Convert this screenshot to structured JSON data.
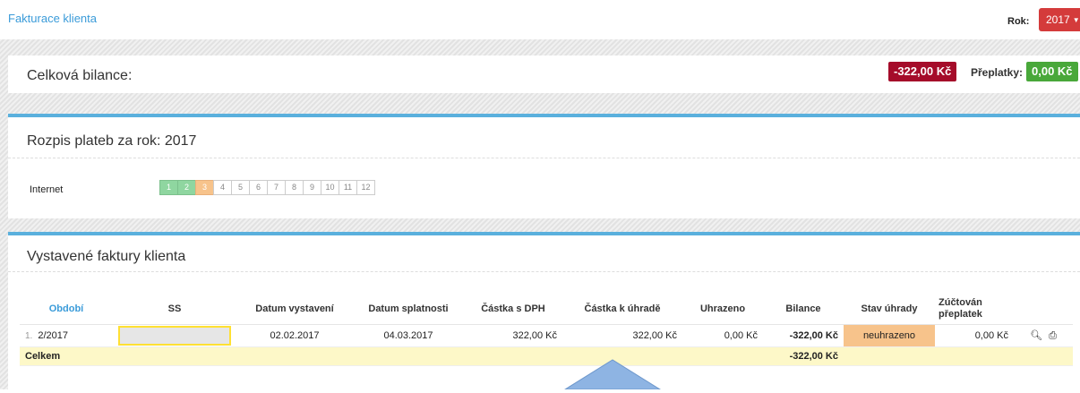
{
  "header": {
    "title": "Fakturace klienta",
    "year_label": "Rok:",
    "year_value": "2017"
  },
  "summary": {
    "title": "Celková bilance:",
    "balance": "-322,00 Kč",
    "overpay_label": "Přeplatky:",
    "overpay": "0,00 Kč",
    "colors": {
      "negative": "#a50c2a",
      "positive": "#49a83a"
    }
  },
  "rozpis": {
    "title": "Rozpis plateb za rok: 2017",
    "service": "Internet",
    "months": [
      {
        "label": "1",
        "state": "paid"
      },
      {
        "label": "2",
        "state": "paid"
      },
      {
        "label": "3",
        "state": "partial"
      },
      {
        "label": "4",
        "state": "none"
      },
      {
        "label": "5",
        "state": "none"
      },
      {
        "label": "6",
        "state": "none"
      },
      {
        "label": "7",
        "state": "none"
      },
      {
        "label": "8",
        "state": "none"
      },
      {
        "label": "9",
        "state": "none"
      },
      {
        "label": "10",
        "state": "none"
      },
      {
        "label": "11",
        "state": "none"
      },
      {
        "label": "12",
        "state": "none"
      }
    ]
  },
  "invoices": {
    "title": "Vystavené faktury klienta",
    "columns": {
      "obdobi": "Období",
      "ss": "SS",
      "datum_vystaveni": "Datum vystavení",
      "datum_splatnosti": "Datum splatnosti",
      "castka_dph": "Částka s DPH",
      "castka_k_uhrade": "Částka k úhradě",
      "uhrazeno": "Uhrazeno",
      "bilance": "Bilance",
      "stav_uhrady": "Stav úhrady",
      "zuctovan": "Zúčtován přeplatek"
    },
    "rows": [
      {
        "num": "1.",
        "obdobi": "2/2017",
        "ss": "",
        "datum_vystaveni": "02.02.2017",
        "datum_splatnosti": "04.03.2017",
        "castka_dph": "322,00 Kč",
        "castka_k_uhrade": "322,00 Kč",
        "uhrazeno": "0,00 Kč",
        "bilance": "-322,00 Kč",
        "stav_uhrady": "neuhrazeno",
        "zuctovan": "0,00 Kč"
      }
    ],
    "total": {
      "label": "Celkem",
      "bilance": "-322,00 Kč"
    },
    "icons": [
      "search-icon",
      "print-icon"
    ]
  }
}
